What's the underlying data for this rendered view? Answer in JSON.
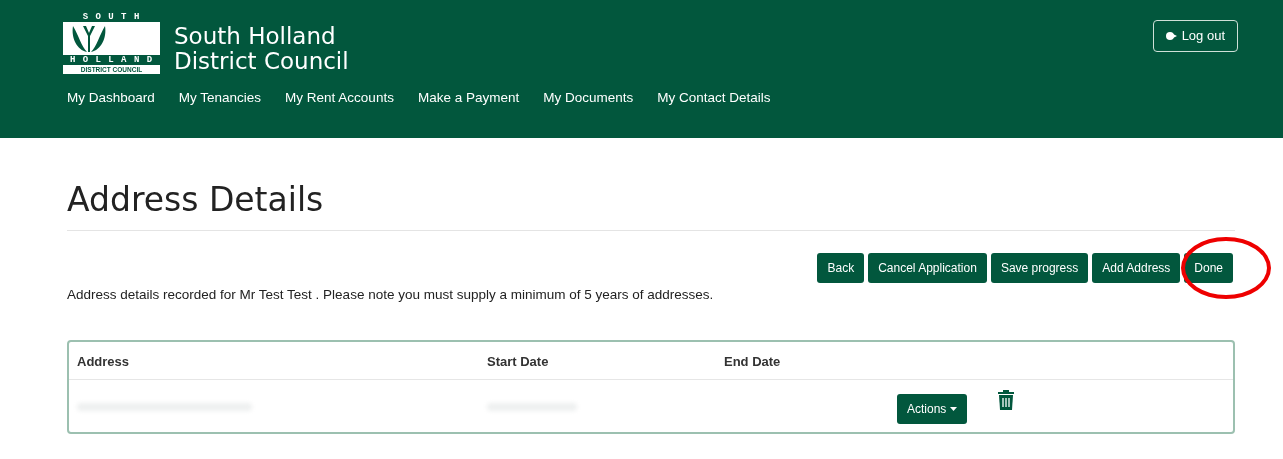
{
  "header": {
    "logo": {
      "top": "S O U T H",
      "middle": "H O L L A N D",
      "bottom": "DISTRICT COUNCIL"
    },
    "title_lines": [
      "South Holland",
      "District Council"
    ],
    "logout": "Log out"
  },
  "nav": [
    {
      "label": "My Dashboard"
    },
    {
      "label": "My Tenancies"
    },
    {
      "label": "My Rent Accounts"
    },
    {
      "label": "Make a Payment"
    },
    {
      "label": "My Documents"
    },
    {
      "label": "My Contact Details"
    }
  ],
  "page": {
    "title": "Address Details",
    "buttons": [
      {
        "label": "Back",
        "circled": false
      },
      {
        "label": "Cancel Application",
        "circled": false
      },
      {
        "label": "Save progress",
        "circled": false
      },
      {
        "label": "Add Address",
        "circled": false
      },
      {
        "label": "Done",
        "circled": true
      }
    ],
    "note": "Address details recorded for Mr Test Test . Please note you must supply a minimum of 5 years of addresses."
  },
  "table": {
    "columns": [
      "Address",
      "Start Date",
      "End Date"
    ],
    "rows": [
      {
        "actions": "Actions"
      }
    ]
  }
}
